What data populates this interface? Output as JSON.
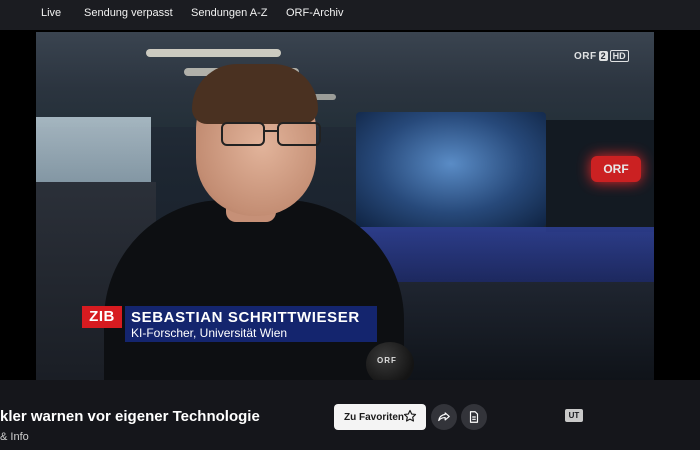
{
  "nav": {
    "items": [
      {
        "label": "Live"
      },
      {
        "label": "Sendung verpasst"
      },
      {
        "label": "Sendungen A-Z"
      },
      {
        "label": "ORF-Archiv"
      }
    ]
  },
  "player": {
    "channel_bug": {
      "brand": "ORF",
      "channel": "2",
      "quality": "HD"
    },
    "background_sign": "ORF",
    "mic_label": "ORF",
    "lower_third": {
      "logo": "ZIB",
      "name": "SEBASTIAN SCHRITTWIESER",
      "role": "KI-Forscher, Universität Wien"
    }
  },
  "video_info": {
    "title": "kler warnen vor eigener Technologie",
    "subtitle": "& Info",
    "favorite_label": "Zu Favoriten",
    "subtitles_badge": "UT"
  },
  "icons": {
    "favorite": "star-icon",
    "share": "share-icon",
    "document": "document-icon"
  },
  "colors": {
    "zib_red": "#d71b20",
    "lower_third_blue": "#14256e",
    "page_bg": "#15161b"
  }
}
